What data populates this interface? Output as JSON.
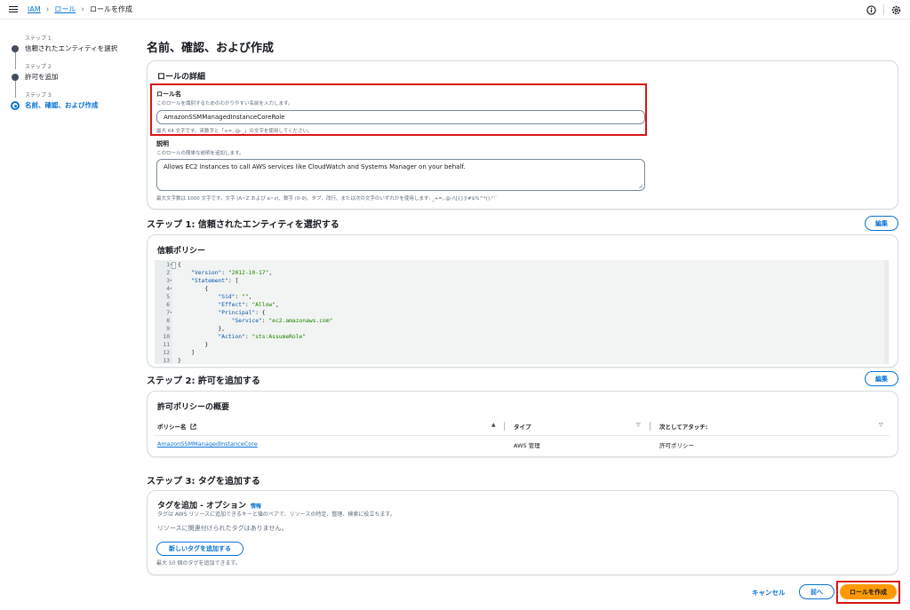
{
  "breadcrumb": {
    "items": [
      "IAM",
      "ロール"
    ],
    "current": "ロールを作成"
  },
  "icons": {
    "menu": "hamburger-icon",
    "info": "info-circle-icon",
    "settings": "gear-icon"
  },
  "steps": [
    {
      "label": "ステップ 1",
      "name": "信頼されたエンティティを選択"
    },
    {
      "label": "ステップ 2",
      "name": "許可を追加"
    },
    {
      "label": "ステップ 3",
      "name": "名前、確認、および作成"
    }
  ],
  "page_title": "名前、確認、および作成",
  "role_details": {
    "title": "ロールの詳細",
    "role_name_label": "ロール名",
    "role_name_desc": "このロールを識別するためのわかりやすい名前を入力します。",
    "role_name_value": "AmazonSSMManagedInstanceCoreRole",
    "role_name_hint": "最大 64 文字です。英数字と「+=,.@-_」の文字を使用してください。",
    "desc_label": "説明",
    "desc_desc": "このロールの簡単な説明を追加します。",
    "desc_value": "Allows EC2 instances to call AWS services like CloudWatch and Systems Manager on your behalf.",
    "desc_hint": "最大文字数は 1000 文字です。文字 (A~Z および a~z)、数字 (0-9)、タブ、改行、または次の文字のいずれかを使用します: _+=,.@-/\\[{}]!#$%^*();\"'`"
  },
  "step1": {
    "heading": "ステップ 1: 信頼されたエンティティを選択する",
    "edit": "編集",
    "card_title": "信頼ポリシー",
    "line_numbers": [
      "1",
      "2",
      "3",
      "4",
      "5",
      "6",
      "7",
      "8",
      "9",
      "10",
      "11",
      "12",
      "13"
    ]
  },
  "step2": {
    "heading": "ステップ 2: 許可を追加する",
    "edit": "編集",
    "card_title": "許可ポリシーの概要",
    "columns": [
      "ポリシー名",
      "タイプ",
      "次としてアタッチ:"
    ],
    "rows": [
      {
        "name": "AmazonSSMManagedInstanceCore",
        "type": "AWS 管理",
        "attached_as": "許可ポリシー"
      }
    ]
  },
  "step3": {
    "heading": "ステップ 3: タグを追加する",
    "card_title": "タグを追加 - オプション",
    "info": "情報",
    "desc": "タグは AWS リソースに追加できるキーと値のペアで、リソースの特定、整理、検索に役立ちます。",
    "empty": "リソースに関連付けられたタグはありません。",
    "add_button": "新しいタグを追加する",
    "hint": "最大 50 個のタグを追加できます。"
  },
  "footer": {
    "cancel": "キャンセル",
    "prev": "前へ",
    "create": "ロールを作成"
  }
}
